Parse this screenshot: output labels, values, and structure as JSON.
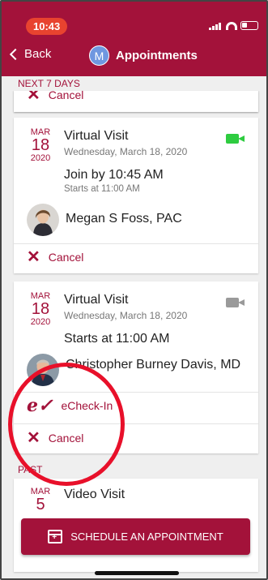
{
  "status_bar": {
    "time": "10:43"
  },
  "nav": {
    "back_label": "Back",
    "avatar_letter": "M",
    "title": "Appointments"
  },
  "sections": {
    "upcoming": "NEXT 7 DAYS",
    "past": "PAST"
  },
  "partial_card": {
    "cancel_label": "Cancel"
  },
  "appointments": [
    {
      "month": "MAR",
      "day": "18",
      "year": "2020",
      "title": "Virtual Visit",
      "date_text": "Wednesday, March 18, 2020",
      "join_text": "Join by 10:45 AM",
      "starts_text": "Starts at 11:00 AM",
      "provider": "Megan S Foss, PAC",
      "video_icon_color": "#2ecc40",
      "cancel_label": "Cancel"
    },
    {
      "month": "MAR",
      "day": "18",
      "year": "2020",
      "title": "Virtual Visit",
      "date_text": "Wednesday, March 18, 2020",
      "starts_text": "Starts at 11:00 AM",
      "provider": "Christopher Burney Davis, MD",
      "video_icon_color": "#9a9a9a",
      "echeckin_label": "eCheck-In",
      "cancel_label": "Cancel"
    }
  ],
  "past": [
    {
      "month": "MAR",
      "day": "5",
      "title": "Video Visit"
    }
  ],
  "schedule_button": {
    "label": "SCHEDULE AN APPOINTMENT"
  },
  "colors": {
    "brand": "#a3123a",
    "time_pill": "#e8432f",
    "highlight_ring": "#e8102a"
  }
}
